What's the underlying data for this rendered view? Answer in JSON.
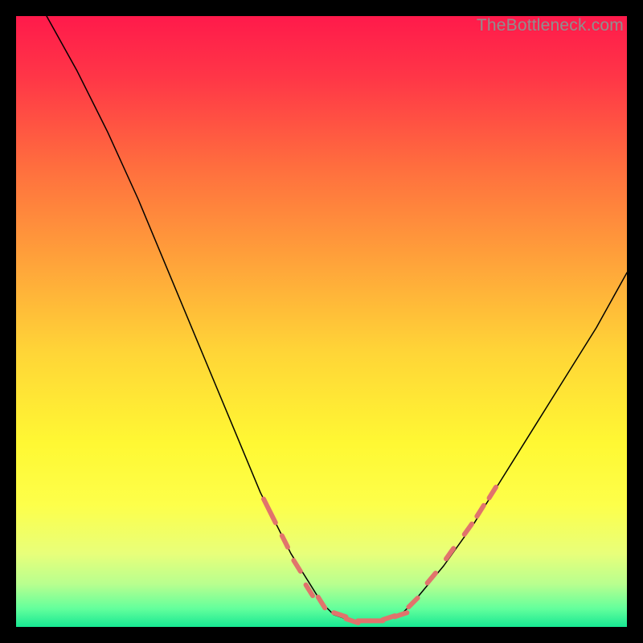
{
  "watermark": "TheBottleneck.com",
  "chart_data": {
    "type": "line",
    "title": "",
    "xlabel": "",
    "ylabel": "",
    "xlim": [
      0,
      100
    ],
    "ylim": [
      0,
      100
    ],
    "grid": false,
    "legend": false,
    "background_gradient": [
      {
        "stop": 0.0,
        "color": "#ff1a4b"
      },
      {
        "stop": 0.1,
        "color": "#ff3647"
      },
      {
        "stop": 0.25,
        "color": "#ff6f3e"
      },
      {
        "stop": 0.4,
        "color": "#ffa23a"
      },
      {
        "stop": 0.55,
        "color": "#ffd537"
      },
      {
        "stop": 0.7,
        "color": "#fff833"
      },
      {
        "stop": 0.8,
        "color": "#fdff4a"
      },
      {
        "stop": 0.88,
        "color": "#e8ff7a"
      },
      {
        "stop": 0.93,
        "color": "#b8ff8f"
      },
      {
        "stop": 0.97,
        "color": "#63ff9c"
      },
      {
        "stop": 1.0,
        "color": "#17e893"
      }
    ],
    "series": [
      {
        "name": "curve",
        "color": "#000000",
        "stroke_width": 1.5,
        "x": [
          5,
          10,
          15,
          20,
          25,
          30,
          35,
          40,
          45,
          50,
          52,
          55,
          60,
          63,
          65,
          70,
          75,
          80,
          85,
          90,
          95,
          100
        ],
        "y": [
          100,
          91,
          81,
          70,
          58,
          46,
          34,
          22,
          12,
          4,
          2,
          1,
          1,
          2,
          4,
          10,
          17,
          25,
          33,
          41,
          49,
          58
        ]
      }
    ],
    "markers": {
      "name": "dashed-segments",
      "color": "#e1736c",
      "stroke_width": 6,
      "description": "Short thick salmon dashes over the curve where y is below ~20 (near the valley floor and lower walls).",
      "points": [
        {
          "x": 41,
          "y": 20
        },
        {
          "x": 42,
          "y": 18
        },
        {
          "x": 44,
          "y": 14
        },
        {
          "x": 46,
          "y": 10
        },
        {
          "x": 48,
          "y": 6
        },
        {
          "x": 50,
          "y": 4
        },
        {
          "x": 53,
          "y": 2
        },
        {
          "x": 55,
          "y": 1
        },
        {
          "x": 57,
          "y": 1
        },
        {
          "x": 59,
          "y": 1
        },
        {
          "x": 61,
          "y": 1.5
        },
        {
          "x": 63,
          "y": 2
        },
        {
          "x": 65,
          "y": 4
        },
        {
          "x": 68,
          "y": 8
        },
        {
          "x": 71,
          "y": 12
        },
        {
          "x": 74,
          "y": 16
        },
        {
          "x": 76,
          "y": 19
        },
        {
          "x": 78,
          "y": 22
        }
      ]
    }
  }
}
